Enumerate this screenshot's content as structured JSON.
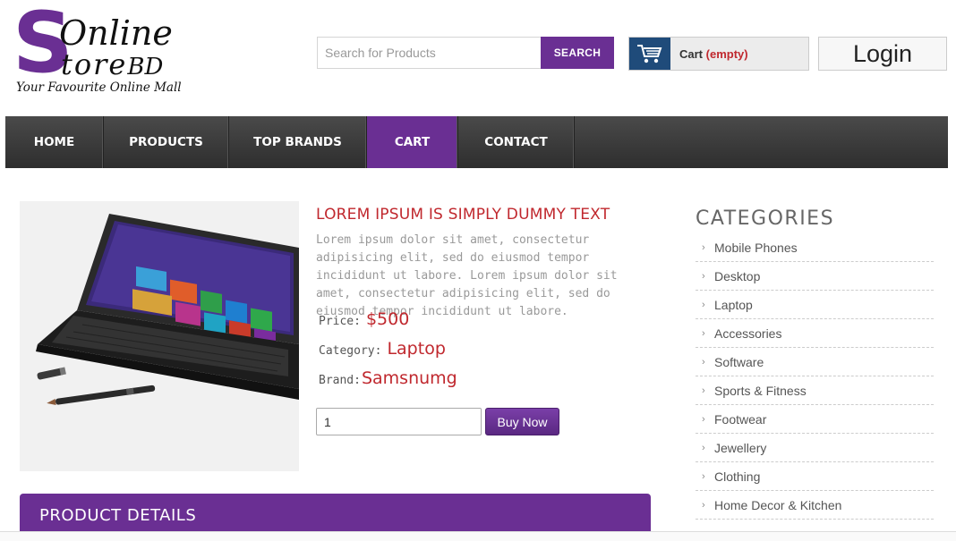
{
  "logo": {
    "s": "S",
    "online": "Online",
    "store": "tore",
    "bd": "BD",
    "tagline": "Your Favourite Online Mall"
  },
  "search": {
    "placeholder": "Search for Products",
    "button": "SEARCH"
  },
  "cart": {
    "label": "Cart",
    "status": "(empty)"
  },
  "login": "Login",
  "nav": [
    {
      "label": "HOME"
    },
    {
      "label": "PRODUCTS"
    },
    {
      "label": "TOP BRANDS"
    },
    {
      "label": "CART",
      "active": true
    },
    {
      "label": "CONTACT"
    }
  ],
  "product": {
    "title": "LOREM IPSUM IS SIMPLY DUMMY TEXT",
    "description": "Lorem ipsum dolor sit amet, consectetur adipisicing elit, sed do eiusmod tempor incididunt ut labore. Lorem ipsum dolor sit amet, consectetur adipisicing elit, sed do eiusmod tempor incididunt ut labore.",
    "price_label": "Price:",
    "price": "$500",
    "category_label": "Category:",
    "category": "Laptop",
    "brand_label": "Brand:",
    "brand": "Samsnumg",
    "quantity": "1",
    "buy_button": "Buy Now"
  },
  "details": {
    "title": "PRODUCT DETAILS"
  },
  "categories": {
    "heading": "CATEGORIES",
    "items": [
      "Mobile Phones",
      "Desktop",
      "Laptop",
      "Accessories",
      "Software",
      "Sports & Fitness",
      "Footwear",
      "Jewellery",
      "Clothing",
      "Home Decor & Kitchen"
    ]
  },
  "colors": {
    "brand_purple": "#6a2f93",
    "accent_red": "#c0282e",
    "nav_dark": "#3a3a3a"
  }
}
